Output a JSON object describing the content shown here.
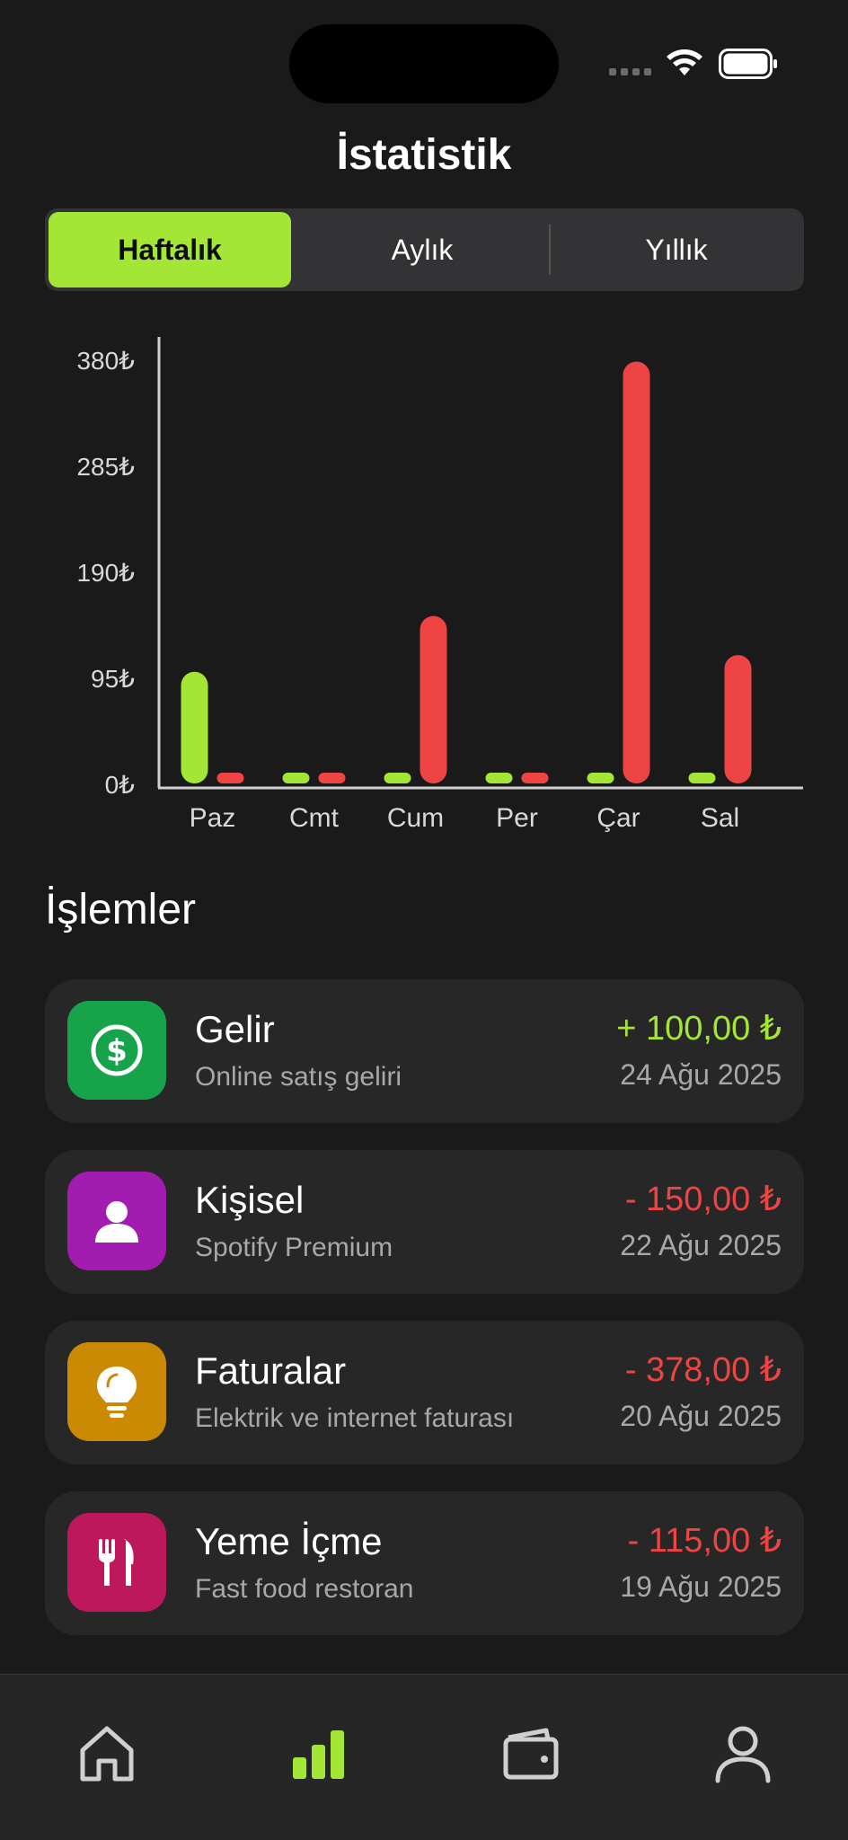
{
  "header": {
    "title": "İstatistik"
  },
  "segments": [
    {
      "label": "Haftalık",
      "active": true
    },
    {
      "label": "Aylık",
      "active": false
    },
    {
      "label": "Yıllık",
      "active": false
    }
  ],
  "colors": {
    "accent": "#a3e635",
    "income": "#a3e635",
    "expense": "#ef4444",
    "background": "#1a1a1a",
    "card": "#272727"
  },
  "chart_data": {
    "type": "bar",
    "categories": [
      "Paz",
      "Cmt",
      "Cum",
      "Per",
      "Çar",
      "Sal"
    ],
    "series": [
      {
        "color": "#a3e635",
        "values": [
          100,
          0,
          0,
          0,
          0,
          0
        ]
      },
      {
        "color": "#ef4444",
        "values": [
          0,
          0,
          150,
          0,
          378,
          115
        ]
      }
    ],
    "yticks": [
      "0₺",
      "95₺",
      "190₺",
      "285₺",
      "380₺"
    ],
    "ylim": [
      0,
      380
    ],
    "grid": false
  },
  "transactions_title": "İşlemler",
  "transactions": [
    {
      "title": "Gelir",
      "subtitle": "Online satış geliri",
      "amount": "+ 100,00 ₺",
      "date": "24 Ağu 2025",
      "type": "income",
      "icon": "dollar-icon",
      "icon_bg": "#16a34a"
    },
    {
      "title": "Kişisel",
      "subtitle": "Spotify Premium",
      "amount": "- 150,00 ₺",
      "date": "22 Ağu 2025",
      "type": "expense",
      "icon": "person-icon",
      "icon_bg": "#a21caf"
    },
    {
      "title": "Faturalar",
      "subtitle": "Elektrik ve internet faturası",
      "amount": "- 378,00 ₺",
      "date": "20 Ağu 2025",
      "type": "expense",
      "icon": "lightbulb-icon",
      "icon_bg": "#ca8a04"
    },
    {
      "title": "Yeme İçme",
      "subtitle": "Fast food restoran",
      "amount": "- 115,00 ₺",
      "date": "19 Ağu 2025",
      "type": "expense",
      "icon": "fork-knife-icon",
      "icon_bg": "#be185d"
    }
  ],
  "tabbar": [
    {
      "icon": "home-icon",
      "active": false
    },
    {
      "icon": "chart-icon",
      "active": true
    },
    {
      "icon": "wallet-icon",
      "active": false
    },
    {
      "icon": "profile-icon",
      "active": false
    }
  ]
}
